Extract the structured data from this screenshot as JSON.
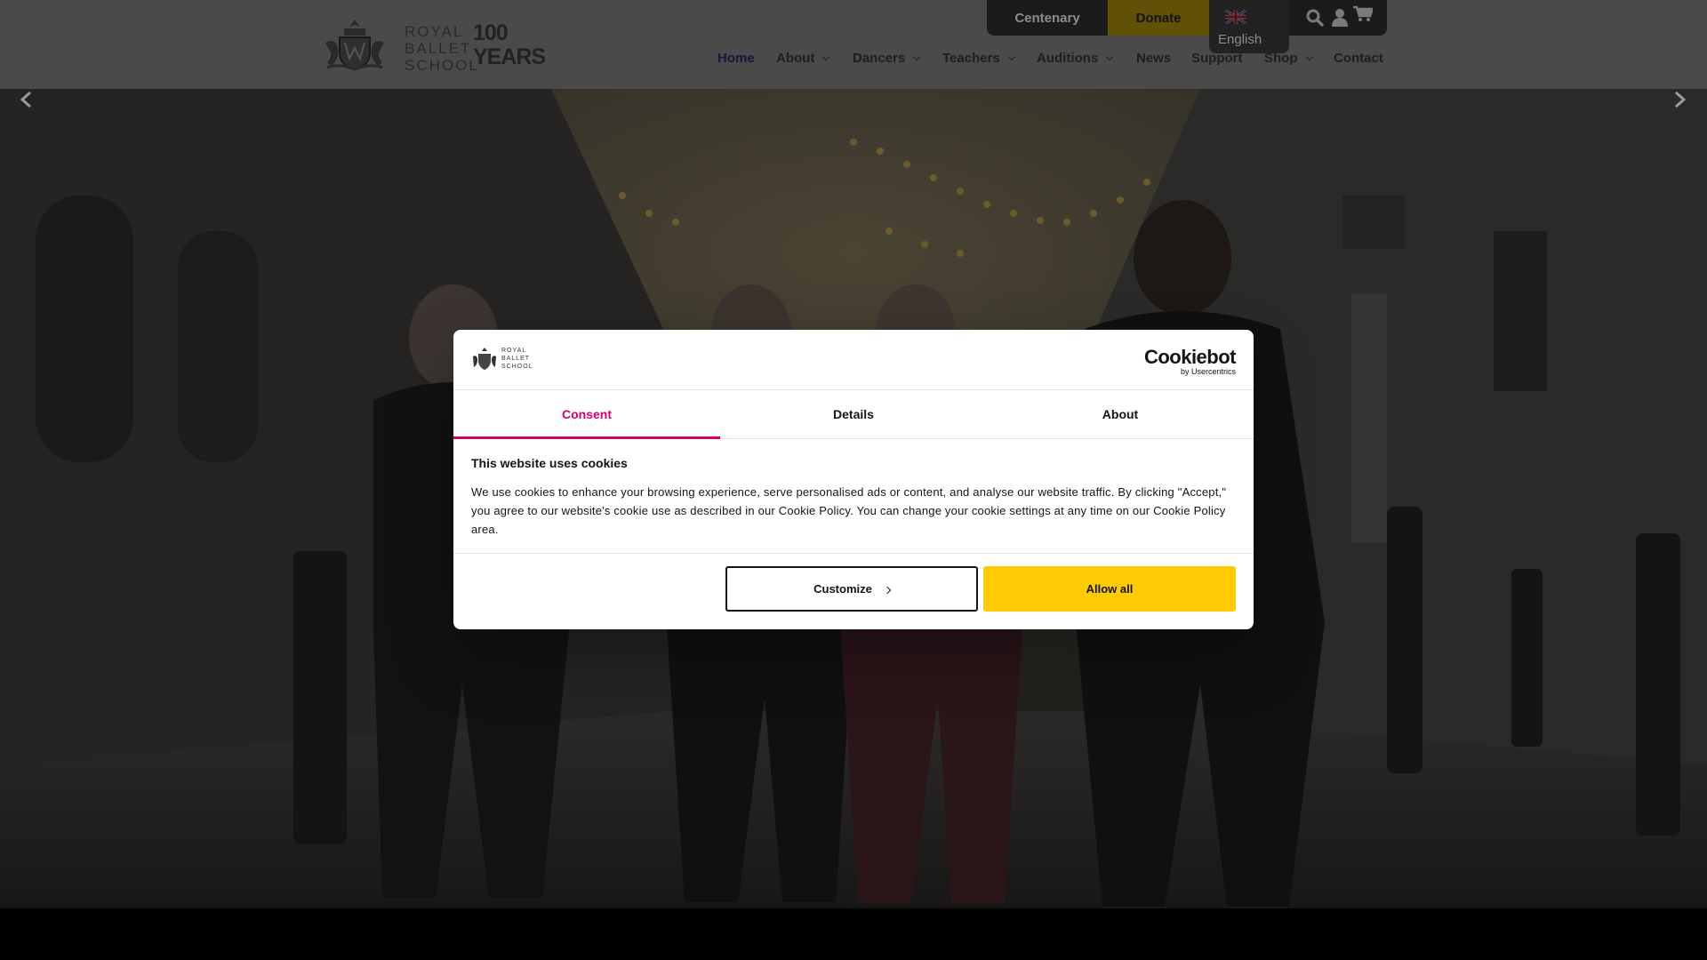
{
  "header": {
    "logo": {
      "line1": "ROYAL",
      "line2": "BALLET",
      "line3": "SCHOOL",
      "centenary_line1": "100",
      "centenary_line2": "YEARS"
    },
    "utility": {
      "centenary_label": "Centenary",
      "donate_label": "Donate"
    },
    "language": {
      "flag": "uk-flag-icon",
      "label": "English"
    },
    "icons": [
      "search-icon",
      "user-icon",
      "cart-icon"
    ],
    "nav": [
      {
        "label": "Home",
        "active": true,
        "dropdown": false
      },
      {
        "label": "About",
        "active": false,
        "dropdown": true
      },
      {
        "label": "Dancers",
        "active": false,
        "dropdown": true
      },
      {
        "label": "Teachers",
        "active": false,
        "dropdown": true
      },
      {
        "label": "Auditions",
        "active": false,
        "dropdown": true
      },
      {
        "label": "News",
        "active": false,
        "dropdown": false
      },
      {
        "label": "Support",
        "active": false,
        "dropdown": false
      },
      {
        "label": "Shop",
        "active": false,
        "dropdown": true
      },
      {
        "label": "Contact",
        "active": false,
        "dropdown": false
      }
    ]
  },
  "hero": {
    "prev_icon": "chevron-left-icon",
    "next_icon": "chevron-right-icon"
  },
  "cookie_dialog": {
    "logo": {
      "line1": "ROYAL",
      "line2": "BALLET",
      "line3": "SCHOOL"
    },
    "provider": {
      "name": "Cookiebot",
      "by": "by Usercentrics"
    },
    "tabs": [
      {
        "label": "Consent",
        "active": true
      },
      {
        "label": "Details",
        "active": false
      },
      {
        "label": "About",
        "active": false
      }
    ],
    "title": "This website uses cookies",
    "body": "We use cookies to enhance your browsing experience, serve personalised ads or content, and analyse our website traffic. By clicking \"Accept,\" you agree to our website's cookie use as described in our Cookie Policy. You can change your cookie settings at any time on our Cookie Policy area.",
    "buttons": {
      "customize": "Customize",
      "allow_all": "Allow all"
    }
  },
  "colors": {
    "accent_tab": "#d6006d",
    "allow_button": "#ffcb05",
    "nav_active": "#15183a"
  }
}
